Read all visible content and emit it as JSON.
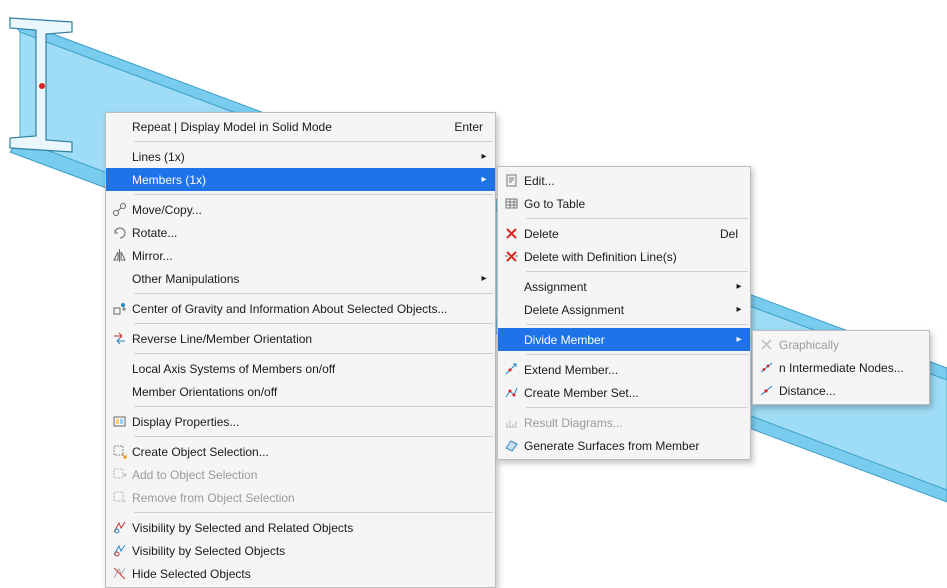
{
  "colors": {
    "highlight": "#1e73e8",
    "beam_fill": "#8fd8f5",
    "beam_edge": "#3a9fc9",
    "disabled": "#9a9a9a"
  },
  "menu1": {
    "repeat": {
      "label": "Repeat | Display Model in Solid Mode",
      "shortcut": "Enter"
    },
    "lines": {
      "label": "Lines (1x)"
    },
    "members": {
      "label": "Members (1x)"
    },
    "move_copy": {
      "label": "Move/Copy..."
    },
    "rotate": {
      "label": "Rotate..."
    },
    "mirror": {
      "label": "Mirror..."
    },
    "other_manip": {
      "label": "Other Manipulations"
    },
    "cog": {
      "label": "Center of Gravity and Information About Selected Objects..."
    },
    "reverse": {
      "label": "Reverse Line/Member Orientation"
    },
    "local_axis": {
      "label": "Local Axis Systems of Members on/off"
    },
    "orientations": {
      "label": "Member Orientations on/off"
    },
    "display_props": {
      "label": "Display Properties..."
    },
    "create_sel": {
      "label": "Create Object Selection..."
    },
    "add_sel": {
      "label": "Add to Object Selection"
    },
    "remove_sel": {
      "label": "Remove from Object Selection"
    },
    "vis_related": {
      "label": "Visibility by Selected and Related Objects"
    },
    "vis_selected": {
      "label": "Visibility by Selected Objects"
    },
    "hide": {
      "label": "Hide Selected Objects"
    }
  },
  "menu2": {
    "edit": {
      "label": "Edit..."
    },
    "go_table": {
      "label": "Go to Table"
    },
    "delete": {
      "label": "Delete",
      "shortcut": "Del"
    },
    "delete_def": {
      "label": "Delete with Definition Line(s)"
    },
    "assignment": {
      "label": "Assignment"
    },
    "del_assign": {
      "label": "Delete Assignment"
    },
    "divide": {
      "label": "Divide Member"
    },
    "extend": {
      "label": "Extend Member..."
    },
    "create_set": {
      "label": "Create Member Set..."
    },
    "result_diag": {
      "label": "Result Diagrams..."
    },
    "gen_surf": {
      "label": "Generate Surfaces from Member"
    }
  },
  "menu3": {
    "graphically": {
      "label": "Graphically"
    },
    "n_nodes": {
      "label": "n Intermediate Nodes..."
    },
    "distance": {
      "label": "Distance..."
    }
  }
}
